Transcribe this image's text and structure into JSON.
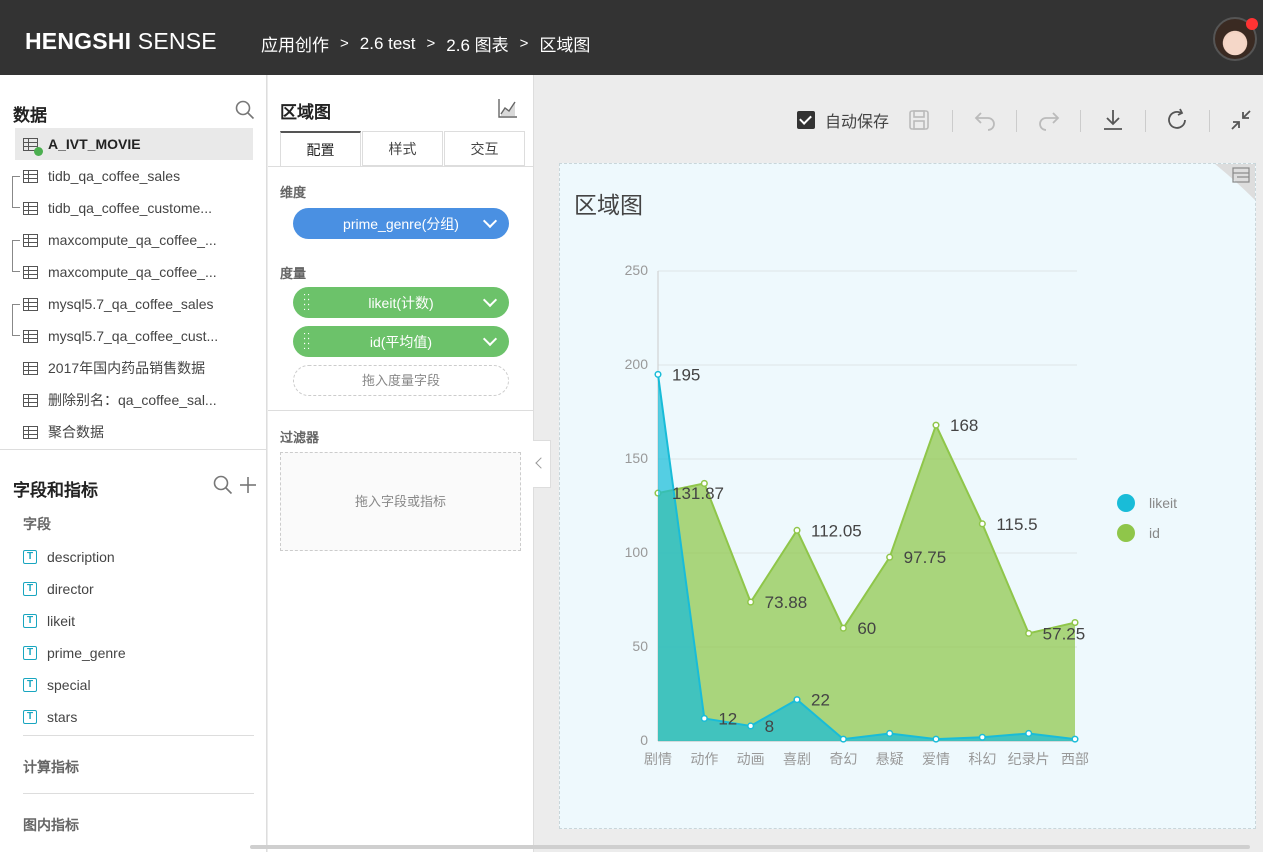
{
  "header": {
    "brand_bold": "HENGSHI",
    "brand_light": "SENSE",
    "breadcrumbs": [
      "应用创作",
      "2.6 test",
      "2.6 图表",
      "区域图"
    ],
    "separator": ">"
  },
  "data_panel": {
    "title": "数据",
    "datasets": [
      {
        "label": "A_IVT_MOVIE",
        "active": true
      },
      {
        "label": "tidb_qa_coffee_sales"
      },
      {
        "label": "tidb_qa_coffee_custome..."
      },
      {
        "label": "maxcompute_qa_coffee_..."
      },
      {
        "label": "maxcompute_qa_coffee_..."
      },
      {
        "label": "mysql5.7_qa_coffee_sales"
      },
      {
        "label": "mysql5.7_qa_coffee_cust..."
      },
      {
        "label": "2017年国内药品销售数据"
      },
      {
        "label": "删除别名：qa_coffee_sal..."
      },
      {
        "label": "聚合数据"
      }
    ]
  },
  "fields_panel": {
    "title": "字段和指标",
    "fields_label": "字段",
    "fields": [
      "description",
      "director",
      "likeit",
      "prime_genre",
      "special",
      "stars"
    ],
    "field_type_glyph": "T",
    "calc_label": "计算指标",
    "chart_label": "图内指标"
  },
  "config_panel": {
    "title": "区域图",
    "tabs": [
      "配置",
      "样式",
      "交互"
    ],
    "dimension_label": "维度",
    "dimension_pill": "prime_genre(分组)",
    "measure_label": "度量",
    "measure_pills": [
      "likeit(计数)",
      "id(平均值)"
    ],
    "measure_drop": "拖入度量字段",
    "filter_label": "过滤器",
    "filter_drop": "拖入字段或指标"
  },
  "toolbar": {
    "autosave_label": "自动保存",
    "autosave_checked": true
  },
  "chart": {
    "title": "区域图",
    "colors": {
      "likeit": "#19bcd8",
      "id": "#8fc64a"
    }
  },
  "chart_data": {
    "type": "area",
    "title": "区域图",
    "categories": [
      "剧情",
      "动作",
      "动画",
      "喜剧",
      "奇幻",
      "悬疑",
      "爱情",
      "科幻",
      "纪录片",
      "西部"
    ],
    "series": [
      {
        "name": "likeit",
        "values": [
          195,
          12,
          8,
          22,
          1,
          4,
          1,
          2,
          4,
          1
        ],
        "labels": [
          "195",
          "12",
          "8",
          "22",
          null,
          null,
          null,
          null,
          null,
          null
        ]
      },
      {
        "name": "id",
        "values": [
          131.87,
          137,
          73.88,
          112.05,
          60,
          97.75,
          168,
          115.5,
          57.25,
          63
        ],
        "labels": [
          "131.87",
          null,
          "73.88",
          "112.05",
          "60",
          "97.75",
          "168",
          "115.5",
          "57.25",
          null
        ]
      }
    ],
    "yticks": [
      0,
      50,
      100,
      150,
      200,
      250
    ],
    "ylim": [
      0,
      250
    ],
    "legend_position": "right",
    "grid": true
  }
}
